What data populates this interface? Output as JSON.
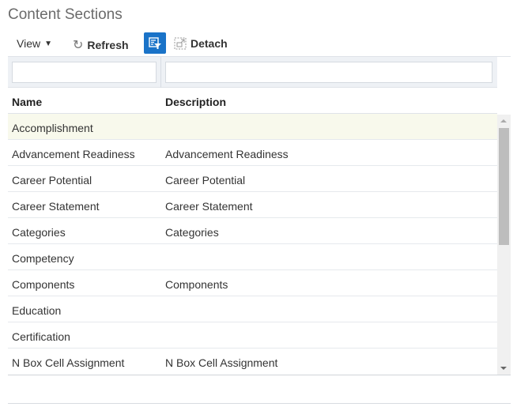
{
  "title": "Content Sections",
  "toolbar": {
    "view": "View",
    "refresh": "Refresh",
    "detach": "Detach"
  },
  "filters": {
    "name": "",
    "description": ""
  },
  "columns": [
    "Name",
    "Description"
  ],
  "rows": [
    [
      "Accomplishment",
      ""
    ],
    [
      "Advancement Readiness",
      "Advancement Readiness"
    ],
    [
      "Career Potential",
      "Career Potential"
    ],
    [
      "Career Statement",
      "Career Statement"
    ],
    [
      "Categories",
      "Categories"
    ],
    [
      "Competency",
      ""
    ],
    [
      "Components",
      "Components"
    ],
    [
      "Education",
      ""
    ],
    [
      "Certification",
      ""
    ],
    [
      "N Box Cell Assignment",
      "N Box Cell Assignment"
    ]
  ],
  "colors": {
    "accent": "#1a73c8",
    "selected_row": "#f8f9ec"
  }
}
